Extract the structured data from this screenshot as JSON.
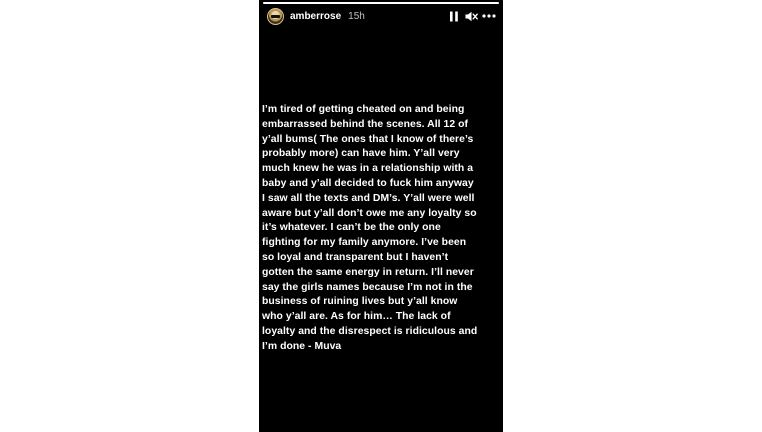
{
  "story": {
    "username": "amberrose",
    "timestamp": "15h",
    "progress": 1.0,
    "icons": {
      "pause": "pause-icon",
      "mute": "mute-icon",
      "more": "more-icon"
    },
    "text": "I’m tired of getting cheated on and being\nembarrassed behind the scenes. All 12 of\ny’all bums( The ones that I know of there’s\nprobably more) can have him. Y’all very\nmuch knew he was in a relationship with a\nbaby and y’all decided to fuck him anyway\nI saw all the texts and DM’s. Y’all were well\naware but y’all don’t owe me any loyalty so\nit’s whatever. I can’t be the only one\nfighting for my family anymore. I’ve been\nso loyal and transparent but I haven’t\ngotten the same energy in return. I’ll never\nsay the girls names because I’m not in the\nbusiness of ruining lives but y’all know\nwho y’all are. As for him… The lack of\nloyalty and the disrespect is ridiculous and\nI’m done - Muva"
  },
  "colors": {
    "background": "#000000",
    "page": "#ffffff",
    "text": "#ffffff"
  }
}
